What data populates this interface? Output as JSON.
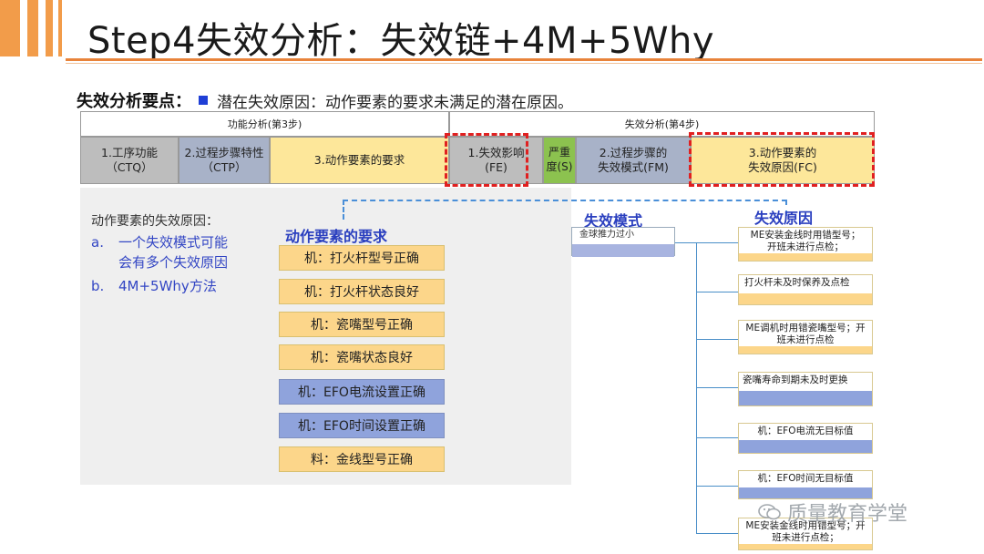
{
  "title": "Step4失效分析：失效链+4M+5Why",
  "key_points": {
    "label": "失效分析要点：",
    "text": "潜在失效原因：动作要素的要求未满足的潜在原因。"
  },
  "header": {
    "function_analysis": "功能分析(第3步)",
    "failure_analysis": "失效分析(第4步)",
    "columns": [
      {
        "line1": "1.工序功能",
        "line2": "（CTQ）"
      },
      {
        "line1": "2.过程步骤特性",
        "line2": "（CTP）"
      },
      {
        "line1": "3.动作要素的要求",
        "line2": ""
      },
      {
        "line1": "1.失效影响",
        "line2": "(FE)"
      },
      {
        "line1": "严重",
        "line2": "度(S)"
      },
      {
        "line1": "2.过程步骤的",
        "line2": "失效模式(FM)"
      },
      {
        "line1": "3.动作要素的",
        "line2": "失效原因(FC)"
      }
    ]
  },
  "causes": {
    "title": "动作要素的失效原因：",
    "items": [
      {
        "marker": "a.",
        "line1": "一个失效模式可能",
        "line2": "会有多个失效原因"
      },
      {
        "marker": "b.",
        "line1": "4M+5Why方法",
        "line2": ""
      }
    ]
  },
  "requirements": {
    "title": "动作要素的要求",
    "items": [
      "机：打火杆型号正确",
      "机：打火杆状态良好",
      "机：瓷嘴型号正确",
      "机：瓷嘴状态良好",
      "机：EFO电流设置正确",
      "机：EFO时间设置正确",
      "料：金线型号正确"
    ]
  },
  "failure_mode": {
    "title": "失效模式",
    "item": "金球推力过小"
  },
  "failure_causes": {
    "title": "失效原因",
    "items": [
      {
        "line1": "ME安装金线时用错型号；",
        "line2": "开班未进行点检；"
      },
      {
        "line1": "打火杆未及时保养及点检",
        "line2": ""
      },
      {
        "line1": "ME调机时用错瓷嘴型号；开",
        "line2": "班未进行点检"
      },
      {
        "line1": "瓷嘴寿命到期未及时更换",
        "line2": ""
      },
      {
        "line1": "机：EFO电流无目标值",
        "line2": ""
      },
      {
        "line1": "机：EFO时间无目标值",
        "line2": ""
      },
      {
        "line1": "ME安装金线时用错型号；开",
        "line2": "班未进行点检；"
      }
    ]
  },
  "watermark": "质量教育学堂",
  "colors": {
    "accent_orange": "#f29c4a",
    "dash_red": "#e02020",
    "title_blue": "#2a3fbf",
    "req_yellow": "#fcd68a",
    "req_blue": "#8fa3dc",
    "green": "#8cc24f"
  }
}
